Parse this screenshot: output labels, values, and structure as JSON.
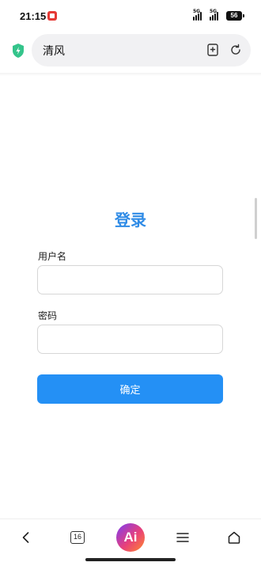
{
  "status_bar": {
    "time": "21:15",
    "signal_1_label": "5G",
    "signal_2_label": "5G",
    "battery": "56"
  },
  "browser": {
    "address_text": "清风",
    "icons": [
      "shield-icon",
      "bookmark-add-icon",
      "reload-icon"
    ]
  },
  "login": {
    "title": "登录",
    "username_label": "用户名",
    "username_value": "",
    "password_label": "密码",
    "password_value": "",
    "submit_label": "确定"
  },
  "bottom_nav": {
    "tab_count": "16",
    "ai_label": "Ai",
    "icons": [
      "back-icon",
      "tabs-icon",
      "ai-assistant-icon",
      "menu-icon",
      "home-icon"
    ]
  },
  "colors": {
    "accent": "#2f8be6",
    "button": "#2490f5",
    "shield": "#34c48b"
  }
}
